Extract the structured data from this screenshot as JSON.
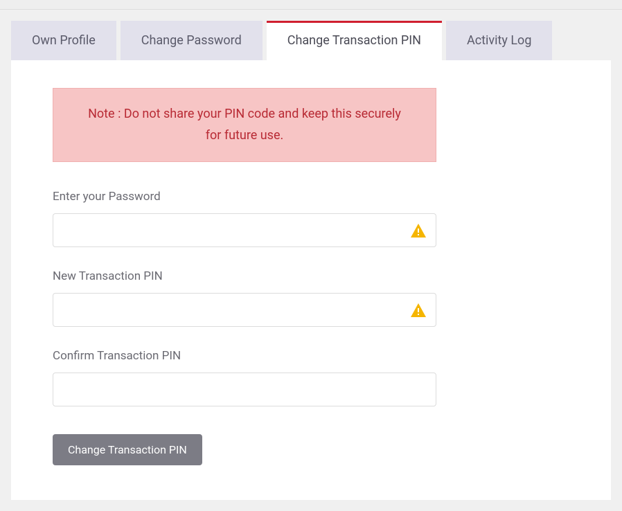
{
  "tabs": {
    "own_profile": "Own Profile",
    "change_password": "Change Password",
    "change_transaction_pin": "Change Transaction PIN",
    "activity_log": "Activity Log"
  },
  "alert": {
    "message": "Note : Do not share your PIN code and keep this securely for future use."
  },
  "form": {
    "password_label": "Enter your Password",
    "new_pin_label": "New Transaction PIN",
    "confirm_pin_label": "Confirm Transaction PIN",
    "submit_label": "Change Transaction PIN"
  }
}
